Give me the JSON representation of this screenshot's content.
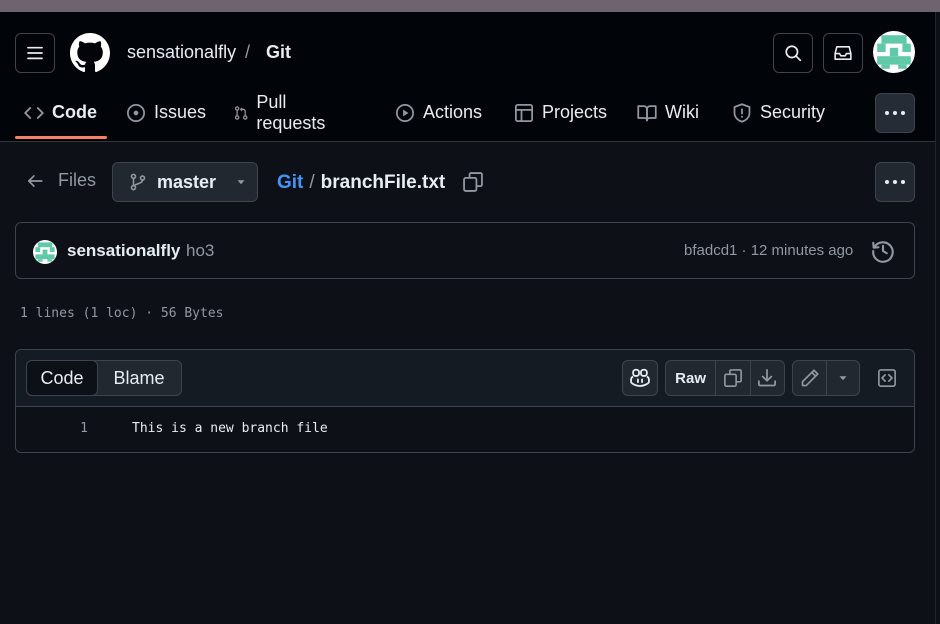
{
  "repo": {
    "owner": "sensationalfly",
    "separator": "/",
    "name": "Git"
  },
  "nav": {
    "tabs": [
      {
        "label": "Code",
        "icon": "code-icon",
        "active": true
      },
      {
        "label": "Issues",
        "icon": "issue-icon"
      },
      {
        "label": "Pull requests",
        "icon": "pull-request-icon"
      },
      {
        "label": "Actions",
        "icon": "play-icon"
      },
      {
        "label": "Projects",
        "icon": "table-icon"
      },
      {
        "label": "Wiki",
        "icon": "book-icon"
      },
      {
        "label": "Security",
        "icon": "shield-icon"
      }
    ]
  },
  "file_header": {
    "files_label": "Files",
    "branch": "master",
    "breadcrumb_repo": "Git",
    "breadcrumb_sep": "/",
    "file_name": "branchFile.txt"
  },
  "commit": {
    "author": "sensationalfly",
    "message": "ho3",
    "meta": "bfadcd1 · 12 minutes ago"
  },
  "file_info": "1 lines (1 loc) · 56 Bytes",
  "code_view": {
    "tab_code": "Code",
    "tab_blame": "Blame",
    "raw_label": "Raw",
    "lines": [
      {
        "number": "1",
        "text": "This is a new branch file"
      }
    ]
  },
  "colors": {
    "background": "#0d1117",
    "header": "#010409",
    "accent_underline": "#f78166",
    "link": "#4493f8",
    "avatar": "#5fc9a8"
  }
}
